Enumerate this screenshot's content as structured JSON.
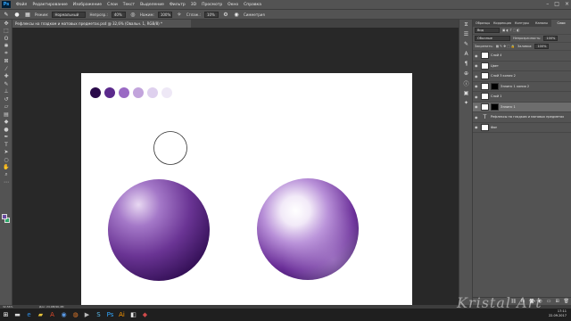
{
  "menubar": {
    "logo": "Ps",
    "items": [
      "Файл",
      "Редактирование",
      "Изображение",
      "Слои",
      "Текст",
      "Выделение",
      "Фильтр",
      "3D",
      "Просмотр",
      "Окно",
      "Справка"
    ]
  },
  "optionbar": {
    "mode_label": "Режим:",
    "mode_value": "Нормальный",
    "opacity_label": "Непрозр.:",
    "opacity_value": "40%",
    "flow_label": "Нажим:",
    "flow_value": "100%",
    "smoothing_label": "Сглаж.:",
    "smoothing_value": "10%",
    "symmetry_label": "Симметрия"
  },
  "document": {
    "tab_title": "Рефлексы на гладком и матовых предметах.psd @ 32,6% (Овальн. 1, RGB/8) *",
    "palette_colors": [
      "#2a0a4a",
      "#5b2a8c",
      "#9a6ac4",
      "#c2a4dc",
      "#ded0ee",
      "#eee8f6"
    ]
  },
  "status": {
    "zoom": "32,56%",
    "doc_info": "Док: 24,9M/96,4M"
  },
  "layers_panel": {
    "tabs": [
      "Образцы",
      "Коррекция",
      "Контуры",
      "Каналы",
      "Слои"
    ],
    "filter_label": "Вид",
    "blend_mode": "Обычные",
    "opacity_label": "Непрозрачность:",
    "opacity_value": "100%",
    "lock_label": "Закрепить:",
    "fill_label": "Заливка:",
    "fill_value": "100%",
    "layers": [
      {
        "name": "Слой 4",
        "type": "pixel",
        "mask": false,
        "selected": false
      },
      {
        "name": "Цвет",
        "type": "pixel",
        "mask": false,
        "selected": false
      },
      {
        "name": "Слой 3 копия 2",
        "type": "pixel",
        "mask": false,
        "selected": false
      },
      {
        "name": "Эллипс 1 копия 2",
        "type": "shape",
        "mask": true,
        "selected": false
      },
      {
        "name": "Слой 1",
        "type": "pixel",
        "mask": false,
        "selected": false
      },
      {
        "name": "Эллипс 1",
        "type": "shape",
        "mask": true,
        "selected": true
      },
      {
        "name": "Рефлексы на гладком и матовых предметах",
        "type": "text",
        "mask": false,
        "selected": false
      },
      {
        "name": "Фон",
        "type": "pixel",
        "mask": false,
        "selected": false
      }
    ]
  },
  "taskbar": {
    "time": "17:11",
    "date": "22.09.2017"
  },
  "watermark": "Kristal Art",
  "colors": {
    "foreground": "#6a4aa0",
    "background": "#2ea86a"
  }
}
